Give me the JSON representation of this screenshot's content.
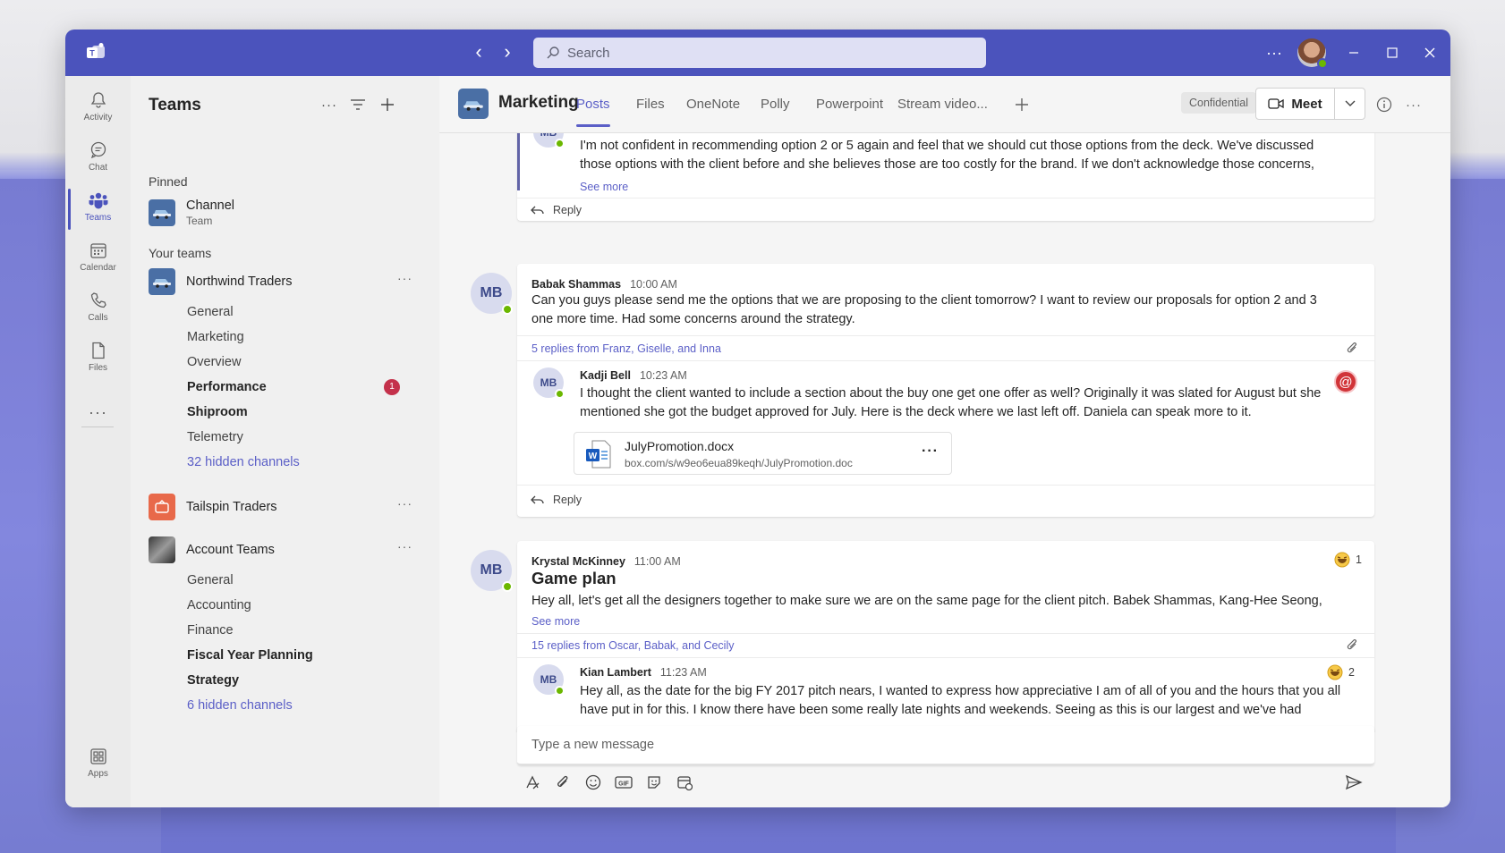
{
  "search": {
    "placeholder": "Search"
  },
  "rail": {
    "items": [
      {
        "label": "Activity",
        "icon": "bell-icon"
      },
      {
        "label": "Chat",
        "icon": "chat-icon"
      },
      {
        "label": "Teams",
        "icon": "teams-icon"
      },
      {
        "label": "Calendar",
        "icon": "calendar-icon"
      },
      {
        "label": "Calls",
        "icon": "phone-icon"
      },
      {
        "label": "Files",
        "icon": "file-icon"
      },
      {
        "label": "Apps",
        "icon": "apps-icon"
      }
    ],
    "active": "Teams"
  },
  "teams_pane": {
    "title": "Teams",
    "pinned_label": "Pinned",
    "pinned": {
      "name": "Channel",
      "sub": "Team"
    },
    "your_teams_label": "Your teams",
    "teams": [
      {
        "name": "Northwind Traders",
        "channels": [
          {
            "name": "General",
            "bold": false
          },
          {
            "name": "Marketing",
            "bold": false
          },
          {
            "name": "Overview",
            "bold": false
          },
          {
            "name": "Performance",
            "bold": true,
            "badge": "1"
          },
          {
            "name": "Shiproom",
            "bold": true
          },
          {
            "name": "Telemetry",
            "bold": false
          }
        ],
        "hidden": "32 hidden channels"
      },
      {
        "name": "Tailspin Traders"
      },
      {
        "name": "Account Teams",
        "channels": [
          {
            "name": "General",
            "bold": false
          },
          {
            "name": "Accounting",
            "bold": false
          },
          {
            "name": "Finance",
            "bold": false
          },
          {
            "name": "Fiscal Year Planning",
            "bold": true
          },
          {
            "name": "Strategy",
            "bold": true
          }
        ],
        "hidden": "6 hidden channels"
      }
    ]
  },
  "channel": {
    "name": "Marketing",
    "tabs": [
      "Posts",
      "Files",
      "OneNote",
      "Polly",
      "Powerpoint",
      "Stream video..."
    ],
    "active_tab": "Posts",
    "sensitivity": "Confidential",
    "meet_label": "Meet"
  },
  "messages": {
    "first": {
      "avatar": "MB",
      "text": "I'm not confident in recommending option 2 or 5 again and feel that we should cut those options from the deck. We've discussed those options with the client before and she believes those are too costly for the brand. If we don't acknowledge those concerns, she may lose confidence in our recommendations.",
      "see_more": "See more",
      "reply": "Reply"
    },
    "second": {
      "avatar": "MB",
      "author": "Babak Shammas",
      "time": "10:00 AM",
      "text": "Can you guys please send me the options that we are proposing to the client tomorrow? I want to review our proposals for option 2 and 3 one more time. Had some concerns around the strategy.",
      "replies_link": "5 replies from Franz, Giselle, and Inna",
      "reply_item": {
        "avatar": "MB",
        "author": "Kadji Bell",
        "time": "10:23 AM",
        "text": "I thought the client wanted to include a section about the buy one get one offer as well? Originally it was slated for August but she mentioned she got the budget approved for July. Here is the deck where we last left off. Daniela can speak more to it.",
        "file": {
          "name": "JulyPromotion.docx",
          "url": "box.com/s/w9eo6eua89keqh/JulyPromotion.doc"
        }
      },
      "reply": "Reply"
    },
    "third": {
      "avatar": "MB",
      "author": "Krystal McKinney",
      "time": "11:00 AM",
      "reaction_count": "1",
      "subject": "Game plan",
      "text": "Hey all, let's get all the designers together to make sure we are on the same page for the client pitch. Babek Shammas, Kang-Hee Seong,",
      "see_more": "See more",
      "replies_link": "15 replies from Oscar, Babak, and Cecily",
      "reply_item": {
        "avatar": "MB",
        "author": "Kian Lambert",
        "time": "11:23 AM",
        "reaction_count": "2",
        "text": "Hey all, as the date for the big FY 2017 pitch nears, I wanted to express how appreciative I am of all of you and the hours that you all have put in for this. I know there have been some really late nights and weekends. Seeing as this is our largest and we've had"
      }
    }
  },
  "compose": {
    "placeholder": "Type a new message"
  },
  "colors": {
    "brand": "#4b53bc",
    "accent": "#5b5fc7",
    "presence": "#6bb700",
    "badge": "#c4314b"
  }
}
